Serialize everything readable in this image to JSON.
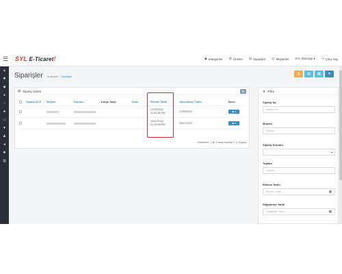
{
  "app": {
    "logo_main": "SYL",
    "logo_sub": "E-Ticaret",
    "logo_bang": "!"
  },
  "header": {
    "nav": [
      {
        "icon": "tag-icon",
        "glyph": "▼",
        "label": "Kategoriler"
      },
      {
        "icon": "box-icon",
        "glyph": "◈",
        "label": "Ürünler"
      },
      {
        "icon": "cart-icon",
        "glyph": "▣",
        "label": "Siparişler"
      },
      {
        "icon": "users-icon",
        "glyph": "◉",
        "label": "Müşteriler"
      },
      {
        "icon": "user-icon",
        "glyph": "",
        "label": "SYL Teknoloji ▾"
      },
      {
        "icon": "logout-icon",
        "glyph": "⇥",
        "label": "Çıkış Yap"
      }
    ]
  },
  "page": {
    "title": "Siparişler",
    "breadcrumb_home": "Anasayfa",
    "breadcrumb_sep": " › ",
    "breadcrumb_current": "Siparişler"
  },
  "list": {
    "panel_title": "Sipariş Listesi",
    "columns": [
      "Sipariş No ▾",
      "Müşteri",
      "Durumu",
      "Kargo Takip",
      "Tutarı",
      "Ekleme Tarihi",
      "Güncelleme Tarihi",
      "İşlem"
    ],
    "rows": [
      {
        "added_date": "27/09/2022",
        "added_time": "11:02:38 PM",
        "updated": "27/09/2022"
      },
      {
        "added_date": "20/07/2022",
        "added_time": "01:29:56 PM",
        "updated": "20/07/2022"
      }
    ],
    "footer": "Gösterilen: 1 ile 2 arası kayıtlar 2 (1 Sayfa)"
  },
  "filter": {
    "title": "Filtre",
    "fields": [
      {
        "label": "Sipariş No",
        "placeholder": "Sipariş No"
      },
      {
        "label": "Müşteri",
        "placeholder": "Müşteri"
      },
      {
        "label": "Sipariş Durumu",
        "placeholder": ""
      },
      {
        "label": "Toplam",
        "placeholder": "Toplam"
      },
      {
        "label": "Ekleme Tarihi",
        "placeholder": "Ekleme Tarihi"
      },
      {
        "label": "Değiştirme Tarihi",
        "placeholder": "Değiştirme Tarihi"
      }
    ]
  },
  "colors": {
    "accent": "#3c8dbc",
    "highlight": "#d32f2f",
    "sidebar": "#2b2f3a"
  }
}
